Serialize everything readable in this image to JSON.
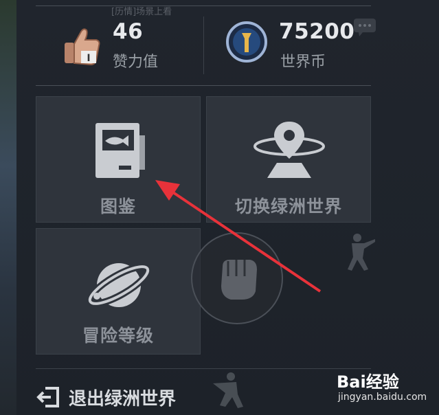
{
  "header": {
    "hint_text": "[历情]场景上看"
  },
  "stats": {
    "likes": {
      "value": "46",
      "label": "赞力值",
      "icon": "thumbs-up-icon"
    },
    "coins": {
      "value": "75200",
      "label": "世界币",
      "icon": "world-coin-icon"
    }
  },
  "tiles": {
    "handbook": {
      "label": "图鉴",
      "icon": "fish-book-icon"
    },
    "switch_world": {
      "label": "切换绿洲世界",
      "icon": "map-pin-orbit-icon"
    },
    "adventure_level": {
      "label": "冒险等级",
      "icon": "planet-icon"
    }
  },
  "exit": {
    "label": "退出绿洲世界",
    "icon": "exit-icon"
  },
  "watermark": {
    "brand": "Bai经验",
    "url": "jingyan.baidu.com"
  },
  "colors": {
    "annotation_arrow": "#e8323a",
    "panel": "#20252d",
    "tile": "#2f343c"
  }
}
